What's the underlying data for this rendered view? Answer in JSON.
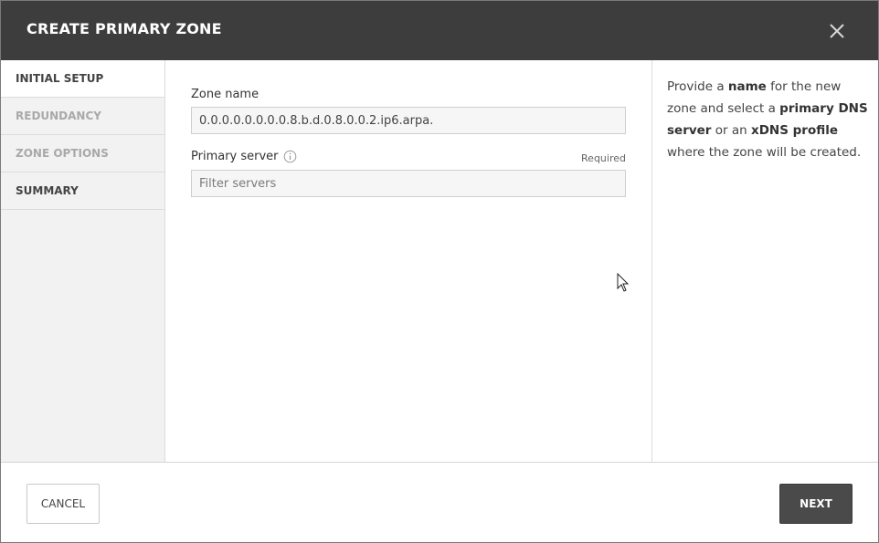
{
  "dialog": {
    "title": "CREATE PRIMARY ZONE",
    "close_icon": "close-icon"
  },
  "sidebar": {
    "steps": [
      {
        "label": "INITIAL SETUP",
        "state": "active"
      },
      {
        "label": "REDUNDANCY",
        "state": "disabled"
      },
      {
        "label": "ZONE OPTIONS",
        "state": "disabled"
      },
      {
        "label": "SUMMARY",
        "state": "enabled"
      }
    ]
  },
  "form": {
    "zone_name": {
      "label": "Zone name",
      "value": "0.0.0.0.0.0.0.0.8.b.d.0.8.0.0.2.ip6.arpa."
    },
    "primary_server": {
      "label": "Primary server",
      "info_icon": "info-icon",
      "required_label": "Required",
      "placeholder": "Filter servers",
      "value": ""
    }
  },
  "help": {
    "t1": "Provide a ",
    "b1": "name",
    "t2": " for the new zone and select a ",
    "b2": "primary DNS server",
    "t3": " or an ",
    "b3": "xDNS profile",
    "t4": " where the zone will be created."
  },
  "footer": {
    "cancel_label": "CANCEL",
    "next_label": "NEXT"
  },
  "colors": {
    "header_bg": "#3d3d3d",
    "sidebar_bg": "#f2f2f2",
    "primary_button_bg": "#4a4a4a"
  }
}
